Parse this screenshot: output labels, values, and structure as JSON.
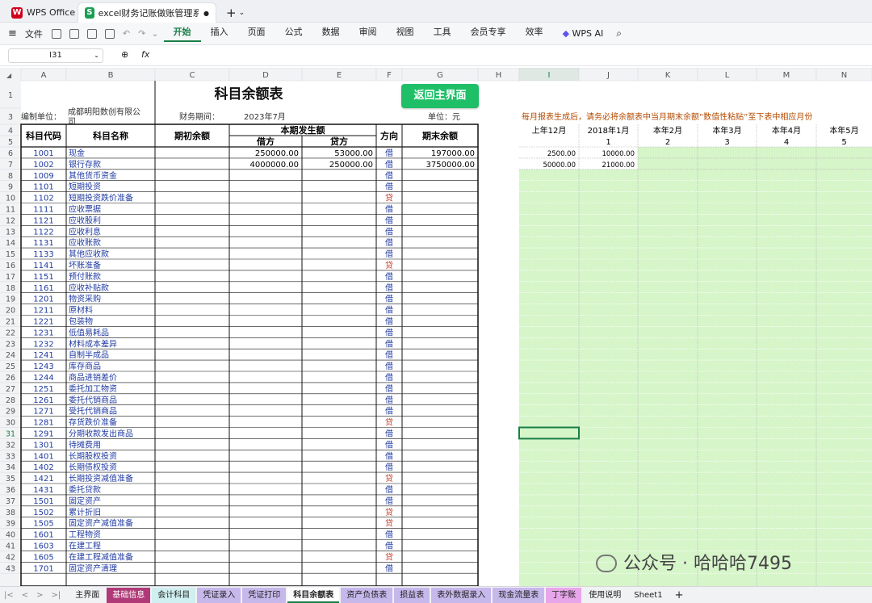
{
  "titlebar": {
    "app_tab": "WPS Office",
    "doc_tab": "excel财务记账做账管理系统...",
    "new_tab": "+"
  },
  "menu": {
    "file": "文件",
    "items": [
      "开始",
      "插入",
      "页面",
      "公式",
      "数据",
      "审阅",
      "视图",
      "工具",
      "会员专享",
      "效率"
    ],
    "wps_ai": "WPS AI"
  },
  "formula": {
    "cell": "I31",
    "fx": "fx"
  },
  "columns": [
    "A",
    "B",
    "C",
    "D",
    "E",
    "F",
    "G",
    "H",
    "I",
    "J",
    "K",
    "L",
    "M",
    "N"
  ],
  "rows": [
    "1",
    "3",
    "4",
    "5",
    "6",
    "7",
    "8",
    "9",
    "10",
    "11",
    "12",
    "13",
    "14",
    "15",
    "16",
    "17",
    "18",
    "19",
    "20",
    "21",
    "22",
    "23",
    "24",
    "25",
    "26",
    "27",
    "28",
    "29",
    "30",
    "31",
    "32",
    "33",
    "34",
    "35",
    "36",
    "37",
    "38",
    "39",
    "40",
    "41",
    "42",
    "43"
  ],
  "sheet": {
    "title": "科目余额表",
    "back_button": "返回主界面",
    "unit_label": "编制单位：",
    "unit_name": "成都明阳数创有限公司",
    "period_label": "财务期间：",
    "period": "2023年7月",
    "currency_label": "单位：元",
    "note": "每月报表生成后，请务必将余额表中当月期末余额“数值性粘贴”至下表中相应月份",
    "headers": {
      "code": "科目代码",
      "name": "科目名称",
      "opening": "期初余额",
      "current": "本期发生额",
      "debit": "借方",
      "credit": "贷方",
      "direction": "方向",
      "closing": "期末余额"
    },
    "month_headers": [
      "上年12月",
      "2018年1月",
      "本年2月",
      "本年3月",
      "本年4月",
      "本年5月"
    ],
    "month_numbers": [
      "",
      "1",
      "2",
      "3",
      "4",
      "5"
    ],
    "accounts": [
      {
        "code": "1001",
        "name": "现金",
        "debit": "250000.00",
        "credit": "53000.00",
        "dir": "借",
        "closing": "197000.00",
        "m0": "2500.00",
        "m1": "10000.00"
      },
      {
        "code": "1002",
        "name": "银行存款",
        "debit": "4000000.00",
        "credit": "250000.00",
        "dir": "借",
        "closing": "3750000.00",
        "m0": "50000.00",
        "m1": "21000.00"
      },
      {
        "code": "1009",
        "name": "其他货币资金",
        "dir": "借"
      },
      {
        "code": "1101",
        "name": "短期投资",
        "dir": "借"
      },
      {
        "code": "1102",
        "name": "短期投资跌价准备",
        "dir": "贷"
      },
      {
        "code": "1111",
        "name": "应收票据",
        "dir": "借"
      },
      {
        "code": "1121",
        "name": "应收股利",
        "dir": "借"
      },
      {
        "code": "1122",
        "name": "应收利息",
        "dir": "借"
      },
      {
        "code": "1131",
        "name": "应收账款",
        "dir": "借"
      },
      {
        "code": "1133",
        "name": "其他应收款",
        "dir": "借"
      },
      {
        "code": "1141",
        "name": "坏账准备",
        "dir": "贷"
      },
      {
        "code": "1151",
        "name": "预付账款",
        "dir": "借"
      },
      {
        "code": "1161",
        "name": "应收补贴款",
        "dir": "借"
      },
      {
        "code": "1201",
        "name": "物资采购",
        "dir": "借"
      },
      {
        "code": "1211",
        "name": "原材料",
        "dir": "借"
      },
      {
        "code": "1221",
        "name": "包装物",
        "dir": "借"
      },
      {
        "code": "1231",
        "name": "低值易耗品",
        "dir": "借"
      },
      {
        "code": "1232",
        "name": "材料成本差异",
        "dir": "借"
      },
      {
        "code": "1241",
        "name": "自制半成品",
        "dir": "借"
      },
      {
        "code": "1243",
        "name": "库存商品",
        "dir": "借"
      },
      {
        "code": "1244",
        "name": "商品进销差价",
        "dir": "借"
      },
      {
        "code": "1251",
        "name": "委托加工物资",
        "dir": "借"
      },
      {
        "code": "1261",
        "name": "委托代销商品",
        "dir": "借"
      },
      {
        "code": "1271",
        "name": "受托代销商品",
        "dir": "借"
      },
      {
        "code": "1281",
        "name": "存货跌价准备",
        "dir": "贷"
      },
      {
        "code": "1291",
        "name": "分期收款发出商品",
        "dir": "借"
      },
      {
        "code": "1301",
        "name": "待摊费用",
        "dir": "借"
      },
      {
        "code": "1401",
        "name": "长期股权投资",
        "dir": "借"
      },
      {
        "code": "1402",
        "name": "长期债权投资",
        "dir": "借"
      },
      {
        "code": "1421",
        "name": "长期投资减值准备",
        "dir": "贷"
      },
      {
        "code": "1431",
        "name": "委托贷款",
        "dir": "借"
      },
      {
        "code": "1501",
        "name": "固定资产",
        "dir": "借"
      },
      {
        "code": "1502",
        "name": "累计折旧",
        "dir": "贷"
      },
      {
        "code": "1505",
        "name": "固定资产减值准备",
        "dir": "贷"
      },
      {
        "code": "1601",
        "name": "工程物资",
        "dir": "借"
      },
      {
        "code": "1603",
        "name": "在建工程",
        "dir": "借"
      },
      {
        "code": "1605",
        "name": "在建工程减值准备",
        "dir": "贷"
      },
      {
        "code": "1701",
        "name": "固定资产清理",
        "dir": "借"
      }
    ]
  },
  "tabs": [
    {
      "label": "主界面",
      "color": "#f1f2f4"
    },
    {
      "label": "基础信息",
      "color": "#b03a78"
    },
    {
      "label": "会计科目",
      "color": "#cfeff0"
    },
    {
      "label": "凭证录入",
      "color": "#c7b8ec"
    },
    {
      "label": "凭证打印",
      "color": "#c7b8ec"
    },
    {
      "label": "科目余额表",
      "color": "#ffffff"
    },
    {
      "label": "资产负债表",
      "color": "#c7b8ec"
    },
    {
      "label": "损益表",
      "color": "#c7b8ec"
    },
    {
      "label": "表外数据录入",
      "color": "#c7b8ec"
    },
    {
      "label": "现金流量表",
      "color": "#c7b8ec"
    },
    {
      "label": "丁字账",
      "color": "#e8a6ea"
    },
    {
      "label": "使用说明",
      "color": "#f1f2f4"
    },
    {
      "label": "Sheet1",
      "color": "#f1f2f4"
    }
  ],
  "watermark": "公众号 · 哈哈哈7495",
  "colors": {
    "accent": "#1a7f47",
    "button": "#1fbf68",
    "green_area": "#d6f5c9",
    "credit_red": "#c0392b",
    "debit_blue": "#1f3aa0"
  }
}
